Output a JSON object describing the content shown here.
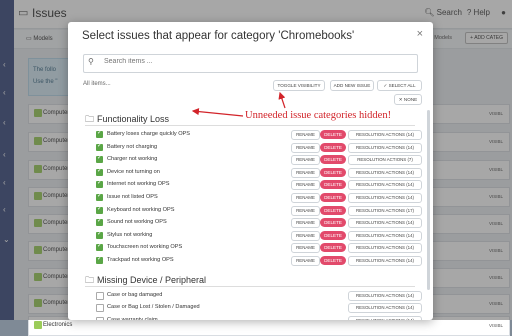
{
  "app": {
    "title": "Issues",
    "search_label": "Search",
    "help_label": "Help",
    "tab_models": "Models",
    "show_all_models": "w All Models",
    "add_category": "+ ADD CATEG",
    "notice_line1": "The follo",
    "notice_line2": "Use the \"",
    "rows": [
      {
        "label": "Computers",
        "visible": "VISIBL"
      },
      {
        "label": "Computers",
        "visible": "VISIBL"
      },
      {
        "label": "Computers",
        "visible": "VISIBL"
      },
      {
        "label": "Computers",
        "visible": "VISIBL"
      },
      {
        "label": "Computers",
        "visible": "VISIBL"
      },
      {
        "label": "Computers",
        "visible": "VISIBL"
      },
      {
        "label": "Computers",
        "visible": "VISIBL"
      },
      {
        "label": "Computers",
        "visible": "VISIBL"
      },
      {
        "label": "Electronics",
        "visible": "VISIBL"
      }
    ]
  },
  "modal": {
    "title": "Select issues that appear for category 'Chromebooks'",
    "search_placeholder": "Search items ...",
    "filter_label": "All items...",
    "toggle_visibility": "TOGGLE VISIBILITY",
    "add_new_issue": "ADD NEW ISSUE",
    "select_all": "✓ SELECT ALL",
    "none": "✕ NONE",
    "rename": "RENAME",
    "delete": "DELETE",
    "categories": [
      {
        "name": "Functionality Loss",
        "items": [
          {
            "label": "Battery loses charge quickly OPS",
            "checked": true,
            "actions": "RESOLUTION ACTIONS (14)"
          },
          {
            "label": "Battery not charging",
            "checked": true,
            "actions": "RESOLUTION ACTIONS (14)"
          },
          {
            "label": "Charger not working",
            "checked": true,
            "actions": "RESOLUTION ACTIONS (7)"
          },
          {
            "label": "Device not turning on",
            "checked": true,
            "actions": "RESOLUTION ACTIONS (14)"
          },
          {
            "label": "Internet not working OPS",
            "checked": true,
            "actions": "RESOLUTION ACTIONS (14)"
          },
          {
            "label": "Issue not listed OPS",
            "checked": true,
            "actions": "RESOLUTION ACTIONS (14)"
          },
          {
            "label": "Keyboard not working OPS",
            "checked": true,
            "actions": "RESOLUTION ACTIONS (17)"
          },
          {
            "label": "Sound not working OPS",
            "checked": true,
            "actions": "RESOLUTION ACTIONS (14)"
          },
          {
            "label": "Stylus not working",
            "checked": true,
            "actions": "RESOLUTION ACTIONS (14)"
          },
          {
            "label": "Touchscreen not working OPS",
            "checked": true,
            "actions": "RESOLUTION ACTIONS (14)"
          },
          {
            "label": "Trackpad not working OPS",
            "checked": true,
            "actions": "RESOLUTION ACTIONS (14)"
          }
        ]
      },
      {
        "name": "Missing Device / Peripheral",
        "items": [
          {
            "label": "Case or bag damaged",
            "checked": false,
            "actions": "RESOLUTION ACTIONS (14)"
          },
          {
            "label": "Case or Bag Lost / Stolen / Damaged",
            "checked": false,
            "actions": "RESOLUTION ACTIONS (14)"
          },
          {
            "label": "Case warranty claim",
            "checked": false,
            "actions": "RESOLUTION ACTIONS (14)"
          }
        ]
      }
    ]
  },
  "annotation": "Unneeded issue categories hidden!",
  "colors": {
    "accent_red": "#d2242a",
    "delete_pink": "#e24a6b",
    "check_green": "#5aa646",
    "nav_blue": "#3c4e80"
  }
}
